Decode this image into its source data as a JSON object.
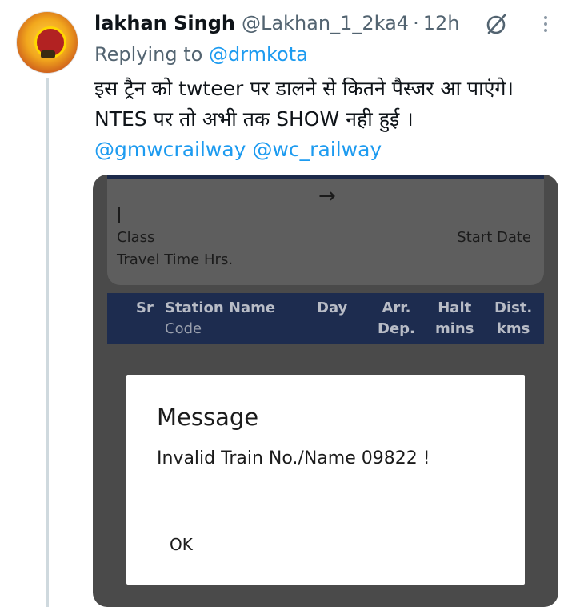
{
  "tweet": {
    "author_name": "lakhan Singh",
    "author_handle": "@Lakhan_1_2ka4",
    "separator": "·",
    "time_ago": "12h",
    "replying_prefix": "Replying to",
    "replying_to": "@drmkota",
    "text_line1": "इस ट्रैन को twteer पर डालने से कितने पैस्जर आ पाएंगे।",
    "text_line2": "NTES पर तो अभी तक SHOW नही हुई ।",
    "mentions": [
      "@gmwcrailway",
      "@wc_railway"
    ]
  },
  "media": {
    "arrow": "→",
    "class_label": "Class",
    "start_date_label": "Start Date",
    "travel_time_label": "Travel Time Hrs.",
    "table_header": {
      "sr": "Sr",
      "station_name": "Station Name",
      "code": "Code",
      "day": "Day",
      "arr": "Arr.",
      "dep": "Dep.",
      "halt": "Halt",
      "mins": "mins",
      "dist": "Dist.",
      "kms": "kms"
    },
    "dialog": {
      "title": "Message",
      "message": "Invalid Train No./Name 09822 !",
      "ok_label": "OK"
    }
  },
  "icons": {
    "grok": "grok-icon",
    "more": "more-options-icon"
  },
  "colors": {
    "link": "#1d9bf0",
    "secondary_text": "#536471",
    "table_header_bg": "#1d2c4f",
    "overlay_bg": "#4a4a4a"
  }
}
